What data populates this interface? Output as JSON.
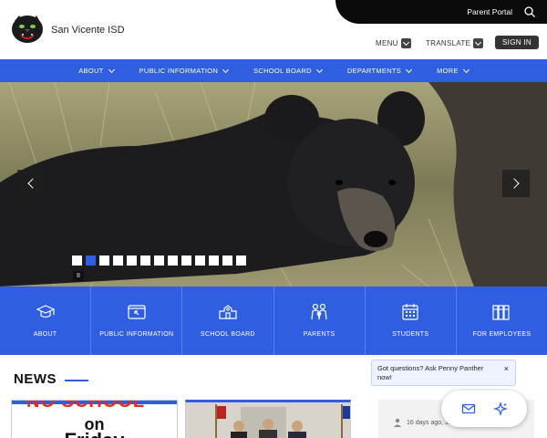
{
  "header": {
    "site_name": "San Vicente ISD",
    "parent_portal": "Parent Portal",
    "menu_label": "MENU",
    "translate_label": "TRANSLATE",
    "signin_label": "SIGN IN"
  },
  "nav": {
    "items": [
      {
        "label": "ABOUT"
      },
      {
        "label": "PUBLIC INFORMATION"
      },
      {
        "label": "SCHOOL BOARD"
      },
      {
        "label": "DEPARTMENTS"
      },
      {
        "label": "MORE"
      }
    ]
  },
  "hero": {
    "slides_total": 13,
    "active_slide": 2,
    "pause_symbol": "II"
  },
  "quick_links": [
    {
      "label": "ABOUT",
      "icon": "graduation-cap-icon"
    },
    {
      "label": "PUBLIC INFORMATION",
      "icon": "public-info-icon"
    },
    {
      "label": "SCHOOL BOARD",
      "icon": "school-building-icon"
    },
    {
      "label": "PARENTS",
      "icon": "parents-icon"
    },
    {
      "label": "STUDENTS",
      "icon": "calendar-icon"
    },
    {
      "label": "FOR EMPLOYEES",
      "icon": "books-icon"
    }
  ],
  "news": {
    "title": "NEWS",
    "card1": {
      "line1": "NO SCHOOL",
      "line2": "on",
      "line3": "Friday"
    },
    "card3": {
      "meta": "16 days ago, Jessie Ivan"
    }
  },
  "chat": {
    "message": "Got questions? Ask Penny Panther now!",
    "close": "×"
  },
  "colors": {
    "brand_blue": "#2f5fe0",
    "black": "#0b0b0b"
  }
}
